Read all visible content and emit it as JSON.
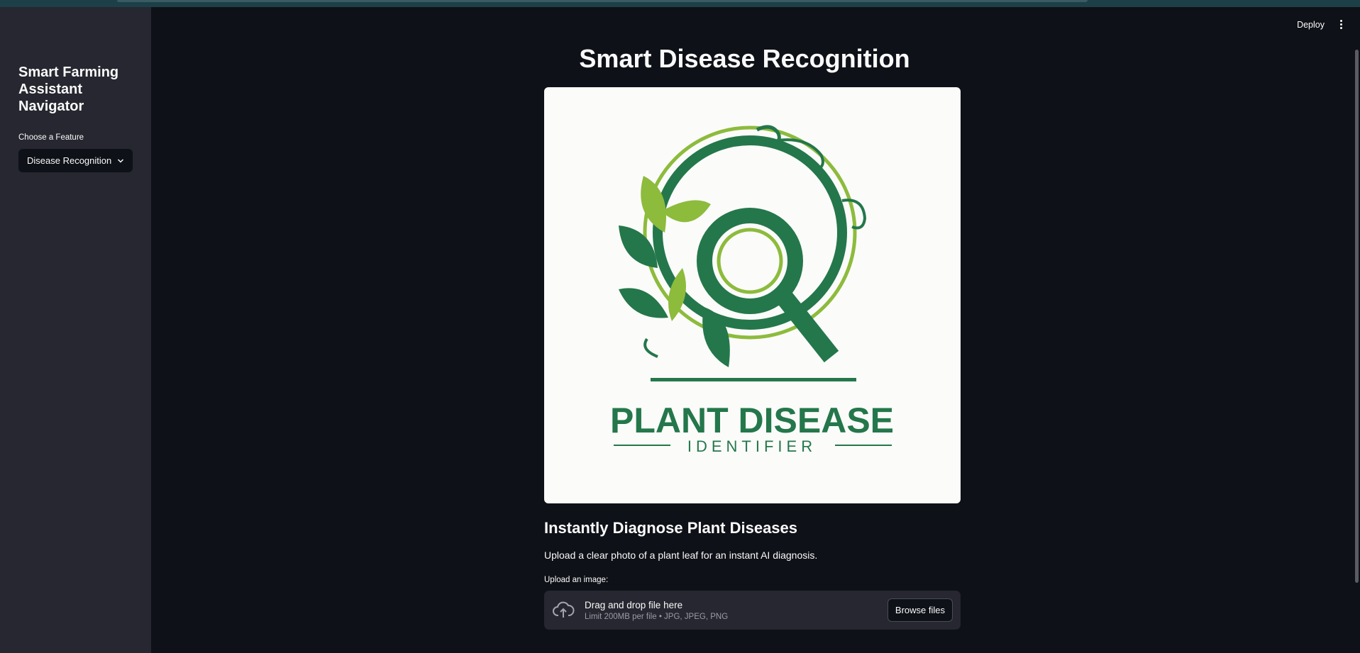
{
  "sidebar": {
    "title": "Smart Farming Assistant Navigator",
    "select_label": "Choose a Feature",
    "selected_feature": "Disease Recognition"
  },
  "header": {
    "deploy_label": "Deploy"
  },
  "main": {
    "title": "Smart Disease Recognition",
    "logo": {
      "line1": "PLANT DISEASE",
      "line2": "IDENTIFIER"
    },
    "subheading": "Instantly Diagnose Plant Diseases",
    "description": "Upload a clear photo of a plant leaf for an instant AI diagnosis.",
    "uploader": {
      "label": "Upload an image:",
      "drop_text": "Drag and drop file here",
      "limit_text": "Limit 200MB per file • JPG, JPEG, PNG",
      "browse_label": "Browse files"
    }
  },
  "colors": {
    "background": "#0e1117",
    "sidebar": "#262730",
    "logo_dark_green": "#24774a",
    "logo_light_green": "#8dbb3c"
  }
}
